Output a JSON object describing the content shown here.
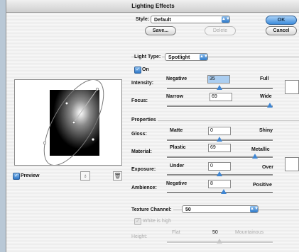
{
  "dialog": {
    "title": "Lighting Effects"
  },
  "style": {
    "label": "Style:",
    "value": "Default"
  },
  "buttons": {
    "ok": "OK",
    "cancel": "Cancel",
    "save": "Save...",
    "delete": "Delete"
  },
  "light": {
    "type_label": "Light Type:",
    "type_value": "Spotlight",
    "on_label": "On"
  },
  "intensity": {
    "label": "Intensity:",
    "min": "Negative",
    "max": "Full",
    "value": "35"
  },
  "focus": {
    "label": "Focus:",
    "min": "Narrow",
    "max": "Wide",
    "value": "69"
  },
  "properties": {
    "header": "Properties",
    "gloss": {
      "label": "Gloss:",
      "min": "Matte",
      "max": "Shiny",
      "value": "0"
    },
    "material": {
      "label": "Material:",
      "min": "Plastic",
      "max": "Metallic",
      "value": "69"
    },
    "exposure": {
      "label": "Exposure:",
      "min": "Under",
      "max": "Over",
      "value": "0"
    },
    "ambience": {
      "label": "Ambience:",
      "min": "Negative",
      "max": "Positive",
      "value": "8"
    }
  },
  "texture": {
    "label": "Texture Channel:",
    "value": "50",
    "white_is_high": "White is high",
    "height_label": "Height:",
    "min": "Flat",
    "max": "Mountainous"
  },
  "preview": {
    "label": "Preview"
  },
  "colors": {
    "accent": "#3f86d3",
    "window_bg": "#f3f3f3",
    "desktop_bg": "#b9c8d6"
  },
  "icons": [
    "light-bulb-icon",
    "trash-icon",
    "popup-arrow-icon",
    "checkmark-icon"
  ]
}
